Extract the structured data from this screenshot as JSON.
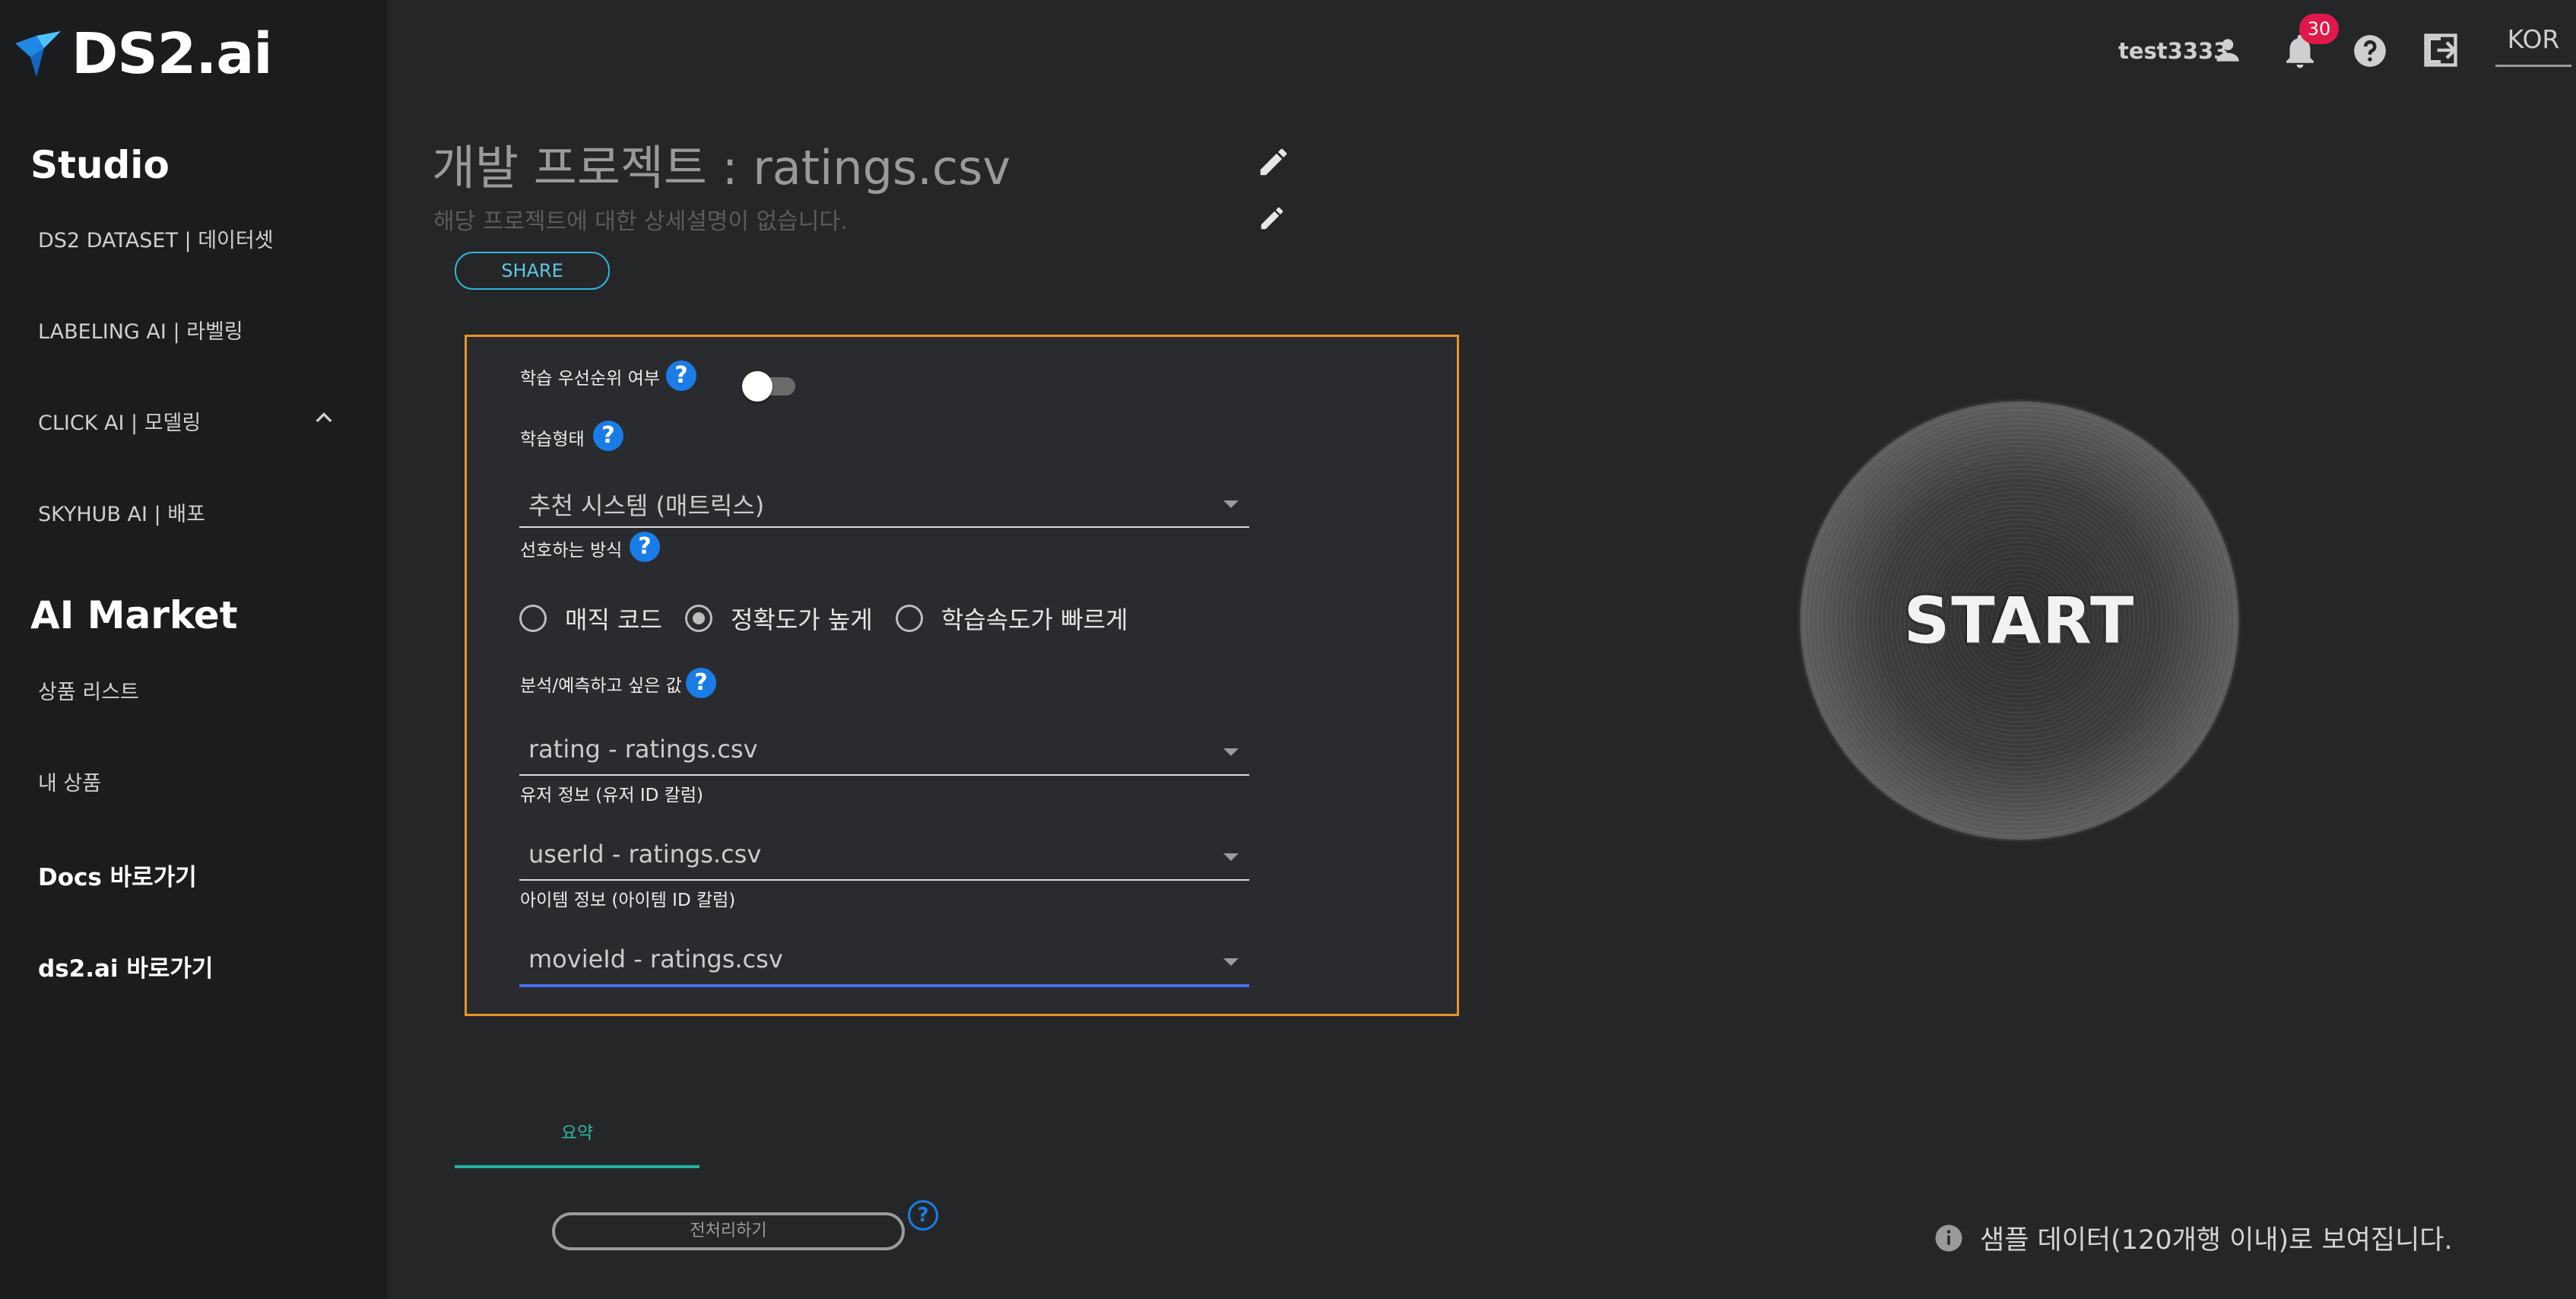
{
  "brand": {
    "logo_text": "DS2.ai"
  },
  "sidebar": {
    "studio_title": "Studio",
    "studio_items": [
      {
        "label": "DS2 DATASET | 데이터셋"
      },
      {
        "label": "LABELING AI | 라벨링"
      },
      {
        "label": "CLICK AI | 모델링"
      },
      {
        "label": "SKYHUB AI | 배포"
      }
    ],
    "market_title": "AI Market",
    "market_items": [
      {
        "label": "상품 리스트"
      },
      {
        "label": "내 상품"
      }
    ],
    "links": [
      {
        "label": "Docs 바로가기"
      },
      {
        "label": "ds2.ai 바로가기"
      }
    ]
  },
  "header": {
    "username": "test3333",
    "notification_count": "30",
    "language": "KOR"
  },
  "project": {
    "title": "개발 프로젝트 : ratings.csv",
    "description": "해당 프로젝트에 대한 상세설명이 없습니다.",
    "share_label": "SHARE"
  },
  "form": {
    "priority_label": "학습 우선순위 여부",
    "priority_enabled": false,
    "learning_type_label": "학습형태",
    "learning_type_value": "추천 시스템 (매트릭스)",
    "preferred_method_label": "선호하는 방식",
    "methods": [
      {
        "label": "매직 코드",
        "selected": false
      },
      {
        "label": "정확도가 높게",
        "selected": true
      },
      {
        "label": "학습속도가 빠르게",
        "selected": false
      }
    ],
    "target_label": "분석/예측하고 싶은 값",
    "target_value": "rating - ratings.csv",
    "user_info_label": "유저 정보 (유저 ID 칼럼)",
    "user_info_value": "userId - ratings.csv",
    "item_info_label": "아이템 정보 (아이템 ID 칼럼)",
    "item_info_value": "movieId - ratings.csv",
    "help_glyph": "?"
  },
  "start_label": "START",
  "bottom": {
    "summary_tab": "요약",
    "preprocess_label": "전처리하기",
    "sample_notice": "샘플 데이터(120개행 이내)로 보여집니다."
  },
  "colors": {
    "accent_orange": "#e9922a",
    "help_blue": "#1a7ce6",
    "teal": "#1fb5a0",
    "badge_red": "#e0194a"
  }
}
